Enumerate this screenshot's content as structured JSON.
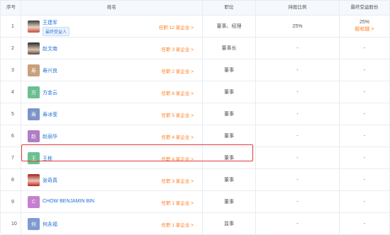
{
  "header": {
    "no": "序号",
    "name": "姓名",
    "position": "职位",
    "pct": "持股比例",
    "ultimate": "最终受益股份"
  },
  "rows": [
    {
      "no": "1",
      "avatar": "",
      "name": "王建军",
      "badge": "最终受益人",
      "roles": "任职 12 家企业 >",
      "position": "董事、经理",
      "pct": "25%",
      "ult": "25%",
      "ult_link": "股权链 >"
    },
    {
      "no": "2",
      "avatar": "",
      "name": "赵文南",
      "roles": "任职 3 家企业 >",
      "position": "董事长",
      "pct": "-",
      "ult": "-"
    },
    {
      "no": "3",
      "avatar": "寿",
      "avatar_color": "#c9a07a",
      "name": "寿兴良",
      "roles": "任职 2 家企业 >",
      "position": "董事",
      "pct": "-",
      "ult": "-"
    },
    {
      "no": "4",
      "avatar": "方",
      "avatar_color": "#6bbf93",
      "name": "方金云",
      "roles": "任职 6 家企业 >",
      "position": "董事",
      "pct": "-",
      "ult": "-"
    },
    {
      "no": "5",
      "avatar": "寿",
      "avatar_color": "#7d94c9",
      "name": "寿冰莹",
      "roles": "任职 5 家企业 >",
      "position": "董事",
      "pct": "-",
      "ult": "-"
    },
    {
      "no": "6",
      "avatar": "赵",
      "avatar_color": "#b07dc5",
      "name": "赵丽华",
      "roles": "任职 4 家企业 >",
      "position": "董事",
      "pct": "-",
      "ult": "-"
    },
    {
      "no": "7",
      "avatar": "王",
      "avatar_color": "#6cc08f",
      "name": "王栋",
      "roles": "任职 4 家企业 >",
      "position": "董事",
      "pct": "-",
      "ult": "-"
    },
    {
      "no": "8",
      "avatar": "",
      "name": "张奇真",
      "roles": "任职 3 家企业 >",
      "position": "董事",
      "pct": "-",
      "ult": "-"
    },
    {
      "no": "9",
      "avatar": "C",
      "avatar_color": "#c67fd0",
      "name": "CHOW BENJAMIN BIN",
      "roles": "任职 1 家企业 >",
      "position": "董事",
      "pct": "-",
      "ult": "-"
    },
    {
      "no": "10",
      "avatar": "何",
      "avatar_color": "#7e9bd1",
      "name": "何永福",
      "roles": "任职 1 家企业 >",
      "position": "监事",
      "pct": "-",
      "ult": "-"
    }
  ]
}
